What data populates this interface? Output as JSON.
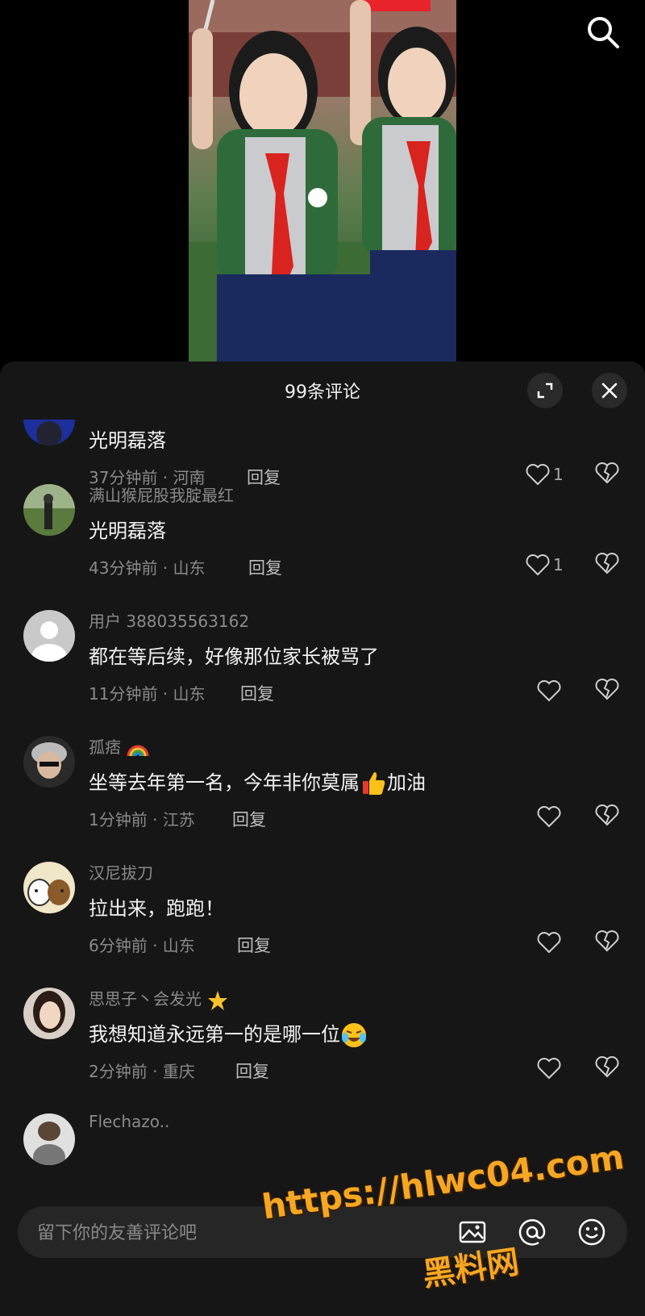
{
  "header": {
    "title": "99条评论"
  },
  "comments": [
    {
      "username": "",
      "text": "光明磊落",
      "time_location": "37分钟前 · 河南",
      "reply": "回复",
      "likes": "1"
    },
    {
      "username": "满山猴屁股我腚最红",
      "text": "光明磊落",
      "time_location": "43分钟前 · 山东",
      "reply": "回复",
      "likes": "1"
    },
    {
      "username": "用户 388035563162",
      "text": "都在等后续，好像那位家长被骂了",
      "time_location": "11分钟前 · 山东",
      "reply": "回复",
      "likes": ""
    },
    {
      "username": "孤痞",
      "text": "坐等去年第一名，今年非你莫属",
      "text_suffix": "加油",
      "time_location": "1分钟前 · 江苏",
      "reply": "回复",
      "likes": ""
    },
    {
      "username": "汉尼拔刀",
      "text": "拉出来，跑跑！",
      "time_location": "6分钟前 · 山东",
      "reply": "回复",
      "likes": ""
    },
    {
      "username": "思思子丶会发光",
      "text": "我想知道永远第一的是哪一位",
      "time_location": "2分钟前 · 重庆",
      "reply": "回复",
      "likes": ""
    },
    {
      "username": "Flechazo..",
      "text": "",
      "time_location": "",
      "reply": "",
      "likes": ""
    }
  ],
  "input": {
    "placeholder": "留下你的友善评论吧"
  },
  "watermark": {
    "line1": "https://hlwc04.com",
    "line2": "黑料网"
  },
  "icons": [
    "search-icon",
    "expand-icon",
    "close-icon",
    "heart-icon",
    "broken-heart-icon",
    "image-icon",
    "at-icon",
    "emoji-icon",
    "rainbow-emoji",
    "thumbs-up-emoji",
    "star-emoji",
    "crying-laughing-emoji"
  ],
  "colors": {
    "sheet_bg": "#161616",
    "input_bg": "#262626",
    "watermark": "#f5a623"
  }
}
